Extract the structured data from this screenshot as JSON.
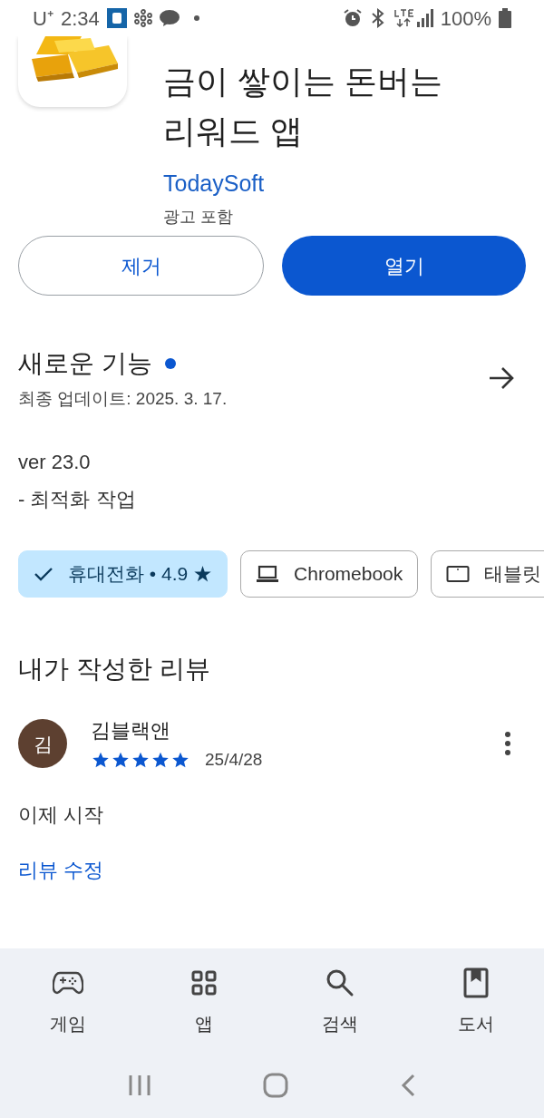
{
  "status_bar": {
    "carrier": "U⁺",
    "time": "2:34",
    "battery": "100%"
  },
  "app": {
    "title_lines": [
      "금이 쌓이는 돈버는",
      "리워드 앱"
    ],
    "developer": "TodaySoft",
    "ads_note": "광고 포함"
  },
  "buttons": [
    {
      "label": "제거",
      "kind": "outline"
    },
    {
      "label": "열기",
      "kind": "filled"
    }
  ],
  "whats_new": {
    "title": "새로운 기능",
    "new_dot": true,
    "updated": "최종 업데이트: 2025. 3. 17.",
    "version": "ver 23.0",
    "notes": "- 최적화 작업"
  },
  "device_chips": [
    {
      "label": "휴대전화 • 4.9 ★",
      "kind": "phone",
      "selected": true
    },
    {
      "label": "Chromebook",
      "kind": "laptop",
      "selected": false
    },
    {
      "label": "태블릿",
      "kind": "tablet",
      "selected": false
    }
  ],
  "my_review": {
    "heading": "내가 작성한 리뷰",
    "avatar_letter": "김",
    "author": "김블랙앤",
    "stars": 5,
    "date": "25/4/28",
    "text": "이제 시작",
    "edit_link": "리뷰 수정"
  },
  "bottom_nav": [
    {
      "label": "게임",
      "kind": "games",
      "selected": false
    },
    {
      "label": "앱",
      "kind": "apps",
      "selected": false
    },
    {
      "label": "검색",
      "kind": "search",
      "selected": false
    },
    {
      "label": "도서",
      "kind": "books",
      "selected": false
    }
  ]
}
